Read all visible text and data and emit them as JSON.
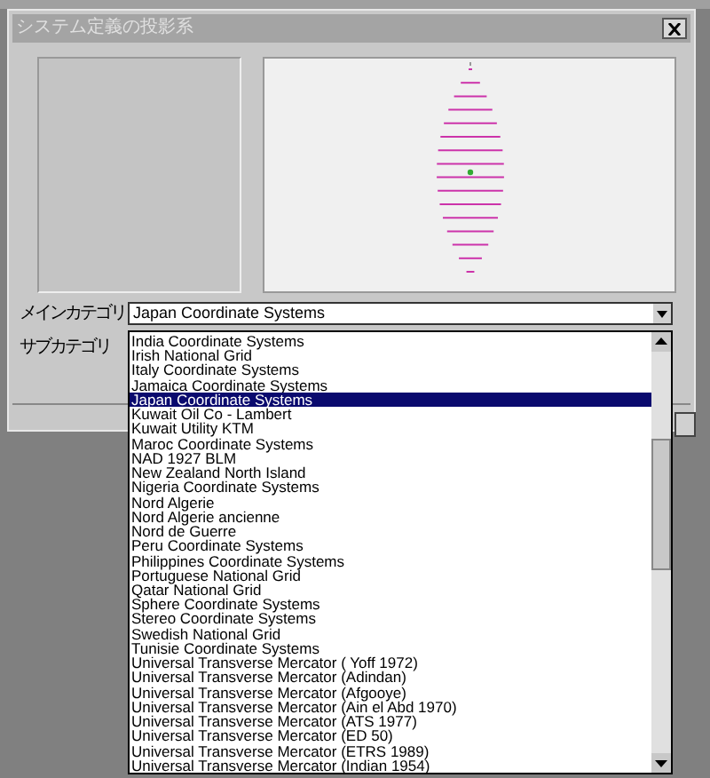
{
  "window": {
    "title": "システム定義の投影系"
  },
  "main_category": {
    "label": "メインカテゴリ",
    "value": "Japan Coordinate Systems"
  },
  "sub_category": {
    "label": "サブカテゴリ"
  },
  "dropdown_items": [
    {
      "label": "India Coordinate Systems",
      "selected": false
    },
    {
      "label": "Irish National Grid",
      "selected": false
    },
    {
      "label": "Italy Coordinate Systems",
      "selected": false
    },
    {
      "label": "Jamaica Coordinate Systems",
      "selected": false
    },
    {
      "label": "Japan Coordinate Systems",
      "selected": true
    },
    {
      "label": "Kuwait Oil Co - Lambert",
      "selected": false
    },
    {
      "label": "Kuwait Utility KTM",
      "selected": false
    },
    {
      "label": "Maroc Coordinate Systems",
      "selected": false
    },
    {
      "label": "NAD 1927 BLM",
      "selected": false
    },
    {
      "label": "New Zealand North Island",
      "selected": false
    },
    {
      "label": "Nigeria Coordinate Systems",
      "selected": false
    },
    {
      "label": "Nord Algerie",
      "selected": false
    },
    {
      "label": "Nord Algerie ancienne",
      "selected": false
    },
    {
      "label": "Nord de Guerre",
      "selected": false
    },
    {
      "label": "Peru Coordinate Systems",
      "selected": false
    },
    {
      "label": "Philippines Coordinate Systems",
      "selected": false
    },
    {
      "label": "Portuguese National Grid",
      "selected": false
    },
    {
      "label": "Qatar National Grid",
      "selected": false
    },
    {
      "label": "Sphere Coordinate Systems",
      "selected": false
    },
    {
      "label": "Stereo Coordinate Systems",
      "selected": false
    },
    {
      "label": "Swedish National Grid",
      "selected": false
    },
    {
      "label": "Tunisie Coordinate Systems",
      "selected": false
    },
    {
      "label": "Universal Transverse Mercator ( Yoff 1972)",
      "selected": false
    },
    {
      "label": "Universal Transverse Mercator (Adindan)",
      "selected": false
    },
    {
      "label": "Universal Transverse Mercator (Afgooye)",
      "selected": false
    },
    {
      "label": "Universal Transverse Mercator (Ain el Abd 1970)",
      "selected": false
    },
    {
      "label": "Universal Transverse Mercator (ATS 1977)",
      "selected": false
    },
    {
      "label": "Universal Transverse Mercator (ED 50)",
      "selected": false
    },
    {
      "label": "Universal Transverse Mercator (ETRS 1989)",
      "selected": false
    },
    {
      "label": "Universal Transverse Mercator (Indian 1954)",
      "selected": false
    }
  ]
}
